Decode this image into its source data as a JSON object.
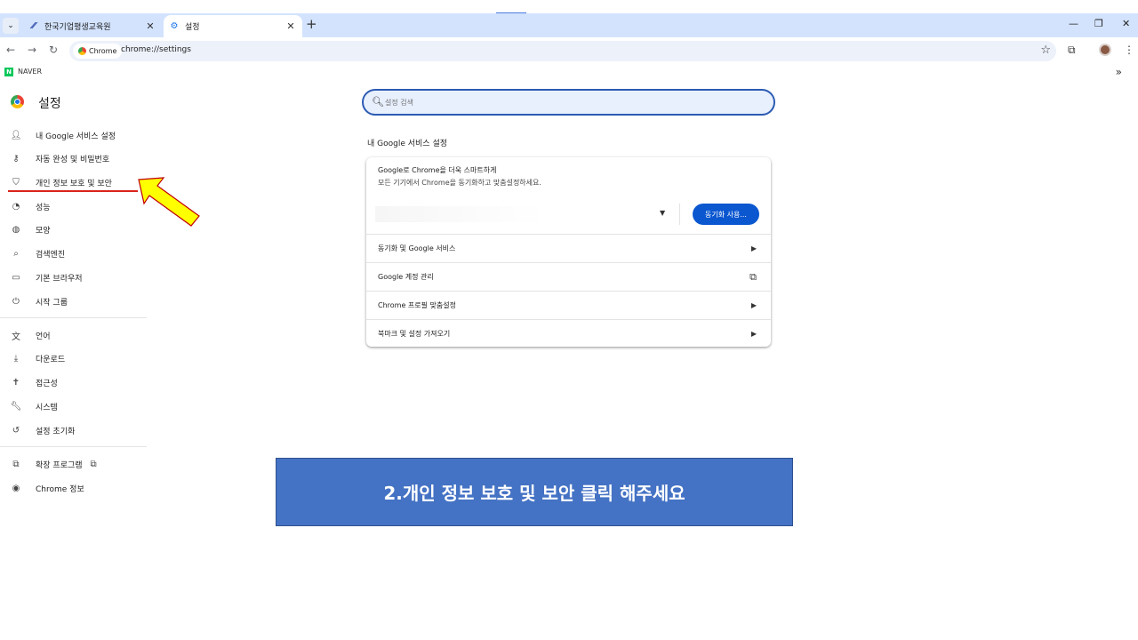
{
  "browser": {
    "tabs": [
      {
        "title": "한국기업평생교육원",
        "icon": "site-favicon-icon"
      },
      {
        "title": "설정",
        "icon": "gear-icon"
      }
    ],
    "new_tab": "+",
    "tab_close": "✕",
    "window_controls": {
      "minimize": "—",
      "restore": "❐",
      "close": "✕"
    },
    "omnibox": {
      "chip_label": "Chrome",
      "url": "chrome://settings"
    },
    "bookmarks": [
      {
        "label": "NAVER",
        "icon_letter": "N"
      }
    ],
    "bookmarks_more": "»"
  },
  "settings": {
    "title": "설정",
    "search_placeholder": "설정 검색",
    "nav": [
      {
        "label": "내 Google 서비스 설정",
        "icon": "person-icon"
      },
      {
        "label": "자동 완성 및 비밀번호",
        "icon": "key-icon"
      },
      {
        "label": "개인 정보 보호 및 보안",
        "icon": "shield-icon"
      },
      {
        "label": "성능",
        "icon": "speedometer-icon"
      },
      {
        "label": "모양",
        "icon": "palette-icon"
      },
      {
        "label": "검색엔진",
        "icon": "search-icon"
      },
      {
        "label": "기본 브라우저",
        "icon": "browser-window-icon"
      },
      {
        "label": "시작 그룹",
        "icon": "power-icon"
      },
      {
        "label": "언어",
        "icon": "translate-icon"
      },
      {
        "label": "다운로드",
        "icon": "download-icon"
      },
      {
        "label": "접근성",
        "icon": "accessibility-icon"
      },
      {
        "label": "시스템",
        "icon": "wrench-icon"
      },
      {
        "label": "설정 초기화",
        "icon": "reset-icon"
      },
      {
        "label": "확장 프로그램",
        "icon": "puzzle-icon"
      },
      {
        "label": "Chrome 정보",
        "icon": "chrome-icon"
      }
    ],
    "section_title": "내 Google 서비스 설정",
    "card": {
      "headline": "Google로 Chrome을 더욱 스마트하게",
      "subtext": "모든 기기에서 Chrome을 동기화하고 맞춤설정하세요.",
      "sync_button": "동기화 사용...",
      "rows": [
        {
          "label": "동기화 및 Google 서비스",
          "icon": "chevron-right-icon"
        },
        {
          "label": "Google 계정 관리",
          "icon": "external-link-icon"
        },
        {
          "label": "Chrome 프로필 맞춤설정",
          "icon": "chevron-right-icon"
        },
        {
          "label": "북마크 및 설정 가져오기",
          "icon": "chevron-right-icon"
        }
      ]
    }
  },
  "annotation": {
    "banner_text": "2.개인 정보 보호 및 보안 클릭 해주세요",
    "arrow_color": "#ffff00",
    "underline_color": "#d9241b",
    "banner_color": "#4472c4"
  }
}
